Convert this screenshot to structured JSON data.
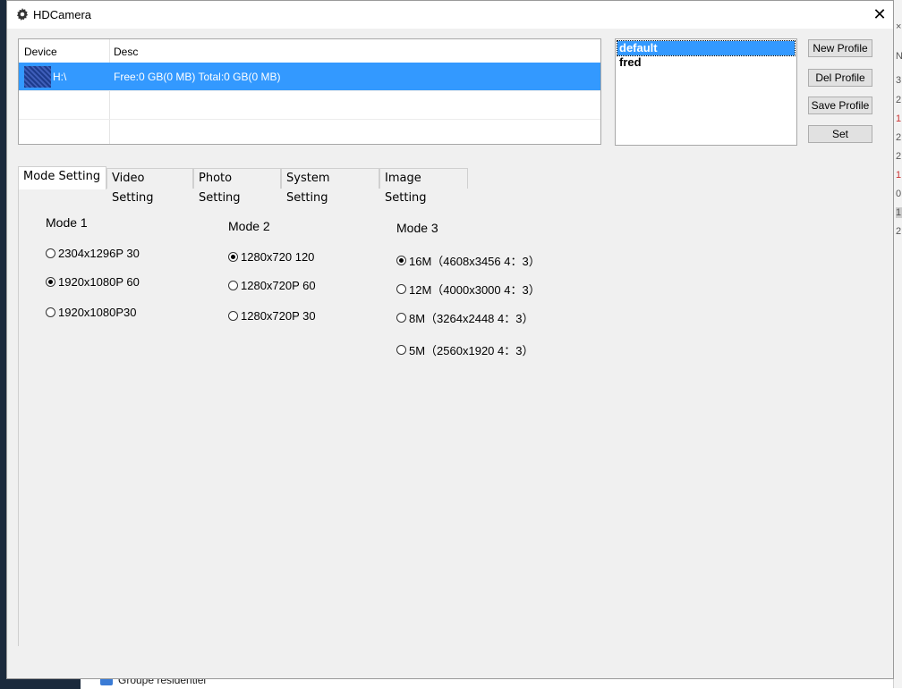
{
  "window": {
    "title": "HDCamera",
    "close_glyph": "✕"
  },
  "device_list": {
    "columns": [
      "Device",
      "Desc"
    ],
    "rows": [
      {
        "device": "H:\\",
        "desc": "Free:0 GB(0 MB) Total:0 GB(0 MB)",
        "selected": true
      }
    ]
  },
  "profiles": {
    "items": [
      {
        "label": "default",
        "selected": true
      },
      {
        "label": "fred",
        "selected": false
      }
    ]
  },
  "buttons": {
    "new_profile": "New Profile",
    "del_profile": "Del Profile",
    "save_profile": "Save Profile",
    "set": "Set"
  },
  "tabs": [
    {
      "label": "Mode Setting",
      "active": true
    },
    {
      "label": "Video Setting",
      "active": false
    },
    {
      "label": "Photo Setting",
      "active": false
    },
    {
      "label": "System Setting",
      "active": false
    },
    {
      "label": "Image Setting",
      "active": false
    }
  ],
  "modes": {
    "mode1": {
      "title": "Mode 1",
      "options": [
        {
          "label": "2304x1296P 30",
          "checked": false
        },
        {
          "label": "1920x1080P 60",
          "checked": true
        },
        {
          "label": "1920x1080P30",
          "checked": false
        }
      ]
    },
    "mode2": {
      "title": "Mode 2",
      "options": [
        {
          "label": "1280x720 120",
          "checked": true
        },
        {
          "label": "1280x720P 60",
          "checked": false
        },
        {
          "label": "1280x720P 30",
          "checked": false
        }
      ]
    },
    "mode3": {
      "title": "Mode 3",
      "options": [
        {
          "label": "16M（4608x3456  4：3）",
          "checked": true
        },
        {
          "label": "12M（4000x3000  4：3）",
          "checked": false
        },
        {
          "label": "8M（3264x2448  4：3）",
          "checked": false
        },
        {
          "label": "5M（2560x1920  4：3）",
          "checked": false
        }
      ]
    }
  },
  "background": {
    "taskbar_item": "Groupe résidentiel",
    "right_edge_chars": [
      "×",
      "N",
      "3",
      "2",
      "1",
      "2",
      "2",
      "1",
      "0",
      "1",
      "2"
    ]
  },
  "icons": {
    "title": "gear-icon",
    "drive": "sd-card-icon"
  },
  "colors": {
    "selection": "#3399ff",
    "window_bg": "#f0f0f0"
  }
}
